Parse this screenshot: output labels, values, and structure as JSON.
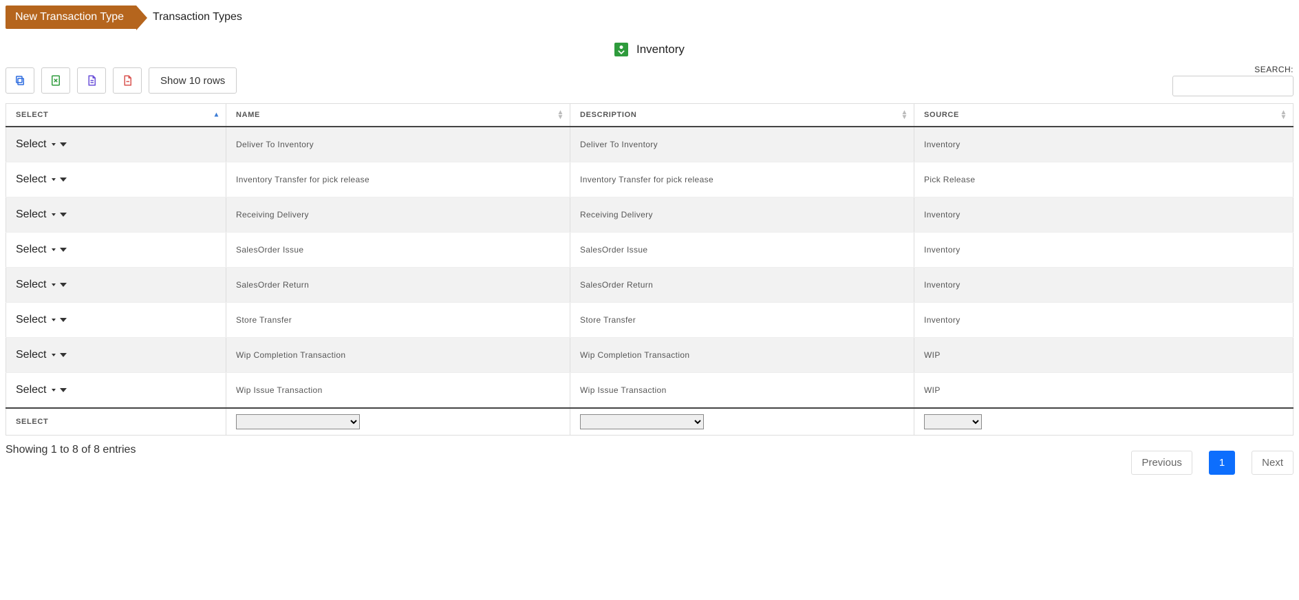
{
  "breadcrumb": {
    "primary": "New Transaction Type",
    "secondary": "Transaction Types"
  },
  "page": {
    "title": "Inventory"
  },
  "toolbar": {
    "show_rows": "Show 10 rows",
    "search_label": "SEARCH:"
  },
  "table": {
    "headers": {
      "select": "SELECT",
      "name": "NAME",
      "description": "DESCRIPTION",
      "source": "SOURCE"
    },
    "select_label": "Select",
    "rows": [
      {
        "name": "Deliver To Inventory",
        "description": "Deliver To Inventory",
        "source": "Inventory"
      },
      {
        "name": "Inventory Transfer for pick release",
        "description": "Inventory Transfer for pick release",
        "source": "Pick Release"
      },
      {
        "name": "Receiving Delivery",
        "description": "Receiving Delivery",
        "source": "Inventory"
      },
      {
        "name": "SalesOrder Issue",
        "description": "SalesOrder Issue",
        "source": "Inventory"
      },
      {
        "name": "SalesOrder Return",
        "description": "SalesOrder Return",
        "source": "Inventory"
      },
      {
        "name": "Store Transfer",
        "description": "Store Transfer",
        "source": "Inventory"
      },
      {
        "name": "Wip Completion Transaction",
        "description": "Wip Completion Transaction",
        "source": "WIP"
      },
      {
        "name": "Wip Issue Transaction",
        "description": "Wip Issue Transaction",
        "source": "WIP"
      }
    ],
    "footer": {
      "select": "SELECT"
    }
  },
  "footer": {
    "info": "Showing 1 to 8 of 8 entries",
    "prev": "Previous",
    "page": "1",
    "next": "Next"
  }
}
